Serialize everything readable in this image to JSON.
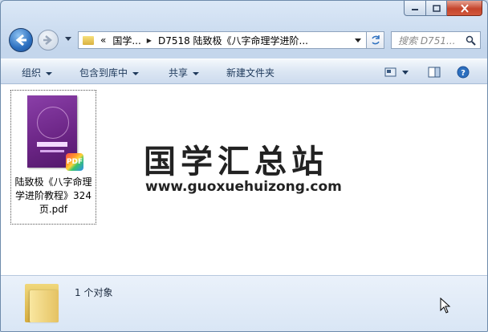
{
  "address": {
    "overflow": "«",
    "segment1": "国学...",
    "segment2": "D7518 陆致极《八字命理学进阶..."
  },
  "search": {
    "placeholder": "搜索 D751..."
  },
  "toolbar": {
    "organize": "组织",
    "include_in_library": "包含到库中",
    "share": "共享",
    "new_folder": "新建文件夹"
  },
  "file": {
    "name": "陆致极《八字命理学进阶教程》324页.pdf",
    "badge": "PDF"
  },
  "watermark": {
    "title": "国学汇总站",
    "url": "www.guoxuehuizong.com"
  },
  "details": {
    "count": "1 个对象"
  },
  "colors": {
    "accent": "#2c6fbf",
    "pdf_cover": "#6a2484"
  }
}
